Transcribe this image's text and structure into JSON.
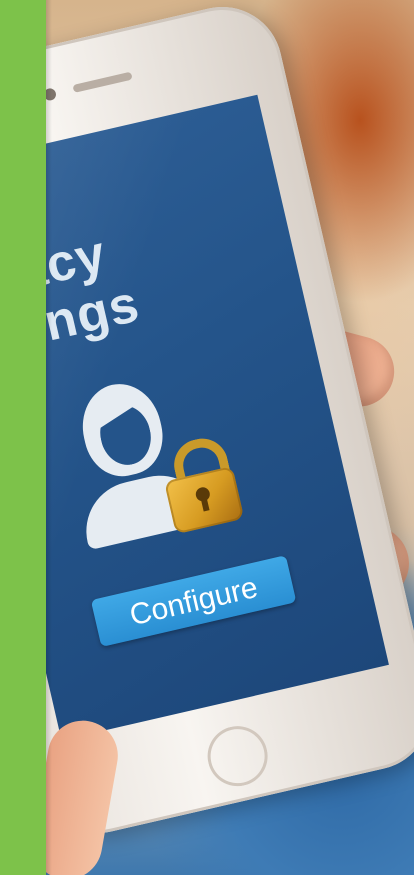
{
  "screen": {
    "title_line1": "Privacy",
    "title_line2": "Settings",
    "button_label": "Configure"
  },
  "icons": {
    "user": "user-avatar-icon",
    "lock": "padlock-icon"
  },
  "colors": {
    "accent_bar": "#7dc24a",
    "screen_bg": "#24548a",
    "button_bg": "#3fa8e6",
    "lock_gold": "#e0a52e"
  }
}
